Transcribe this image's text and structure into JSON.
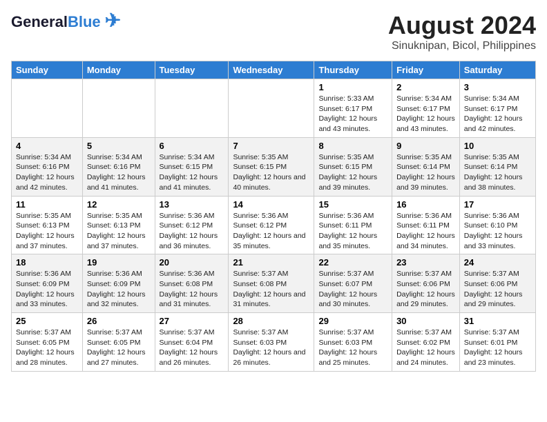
{
  "logo": {
    "line1a": "General",
    "line1b": "Blue",
    "tagline": ""
  },
  "title": "August 2024",
  "subtitle": "Sinuknipan, Bicol, Philippines",
  "days_of_week": [
    "Sunday",
    "Monday",
    "Tuesday",
    "Wednesday",
    "Thursday",
    "Friday",
    "Saturday"
  ],
  "weeks": [
    [
      {
        "day": "",
        "info": ""
      },
      {
        "day": "",
        "info": ""
      },
      {
        "day": "",
        "info": ""
      },
      {
        "day": "",
        "info": ""
      },
      {
        "day": "1",
        "info": "Sunrise: 5:33 AM\nSunset: 6:17 PM\nDaylight: 12 hours\nand 43 minutes."
      },
      {
        "day": "2",
        "info": "Sunrise: 5:34 AM\nSunset: 6:17 PM\nDaylight: 12 hours\nand 43 minutes."
      },
      {
        "day": "3",
        "info": "Sunrise: 5:34 AM\nSunset: 6:17 PM\nDaylight: 12 hours\nand 42 minutes."
      }
    ],
    [
      {
        "day": "4",
        "info": "Sunrise: 5:34 AM\nSunset: 6:16 PM\nDaylight: 12 hours\nand 42 minutes."
      },
      {
        "day": "5",
        "info": "Sunrise: 5:34 AM\nSunset: 6:16 PM\nDaylight: 12 hours\nand 41 minutes."
      },
      {
        "day": "6",
        "info": "Sunrise: 5:34 AM\nSunset: 6:15 PM\nDaylight: 12 hours\nand 41 minutes."
      },
      {
        "day": "7",
        "info": "Sunrise: 5:35 AM\nSunset: 6:15 PM\nDaylight: 12 hours\nand 40 minutes."
      },
      {
        "day": "8",
        "info": "Sunrise: 5:35 AM\nSunset: 6:15 PM\nDaylight: 12 hours\nand 39 minutes."
      },
      {
        "day": "9",
        "info": "Sunrise: 5:35 AM\nSunset: 6:14 PM\nDaylight: 12 hours\nand 39 minutes."
      },
      {
        "day": "10",
        "info": "Sunrise: 5:35 AM\nSunset: 6:14 PM\nDaylight: 12 hours\nand 38 minutes."
      }
    ],
    [
      {
        "day": "11",
        "info": "Sunrise: 5:35 AM\nSunset: 6:13 PM\nDaylight: 12 hours\nand 37 minutes."
      },
      {
        "day": "12",
        "info": "Sunrise: 5:35 AM\nSunset: 6:13 PM\nDaylight: 12 hours\nand 37 minutes."
      },
      {
        "day": "13",
        "info": "Sunrise: 5:36 AM\nSunset: 6:12 PM\nDaylight: 12 hours\nand 36 minutes."
      },
      {
        "day": "14",
        "info": "Sunrise: 5:36 AM\nSunset: 6:12 PM\nDaylight: 12 hours\nand 35 minutes."
      },
      {
        "day": "15",
        "info": "Sunrise: 5:36 AM\nSunset: 6:11 PM\nDaylight: 12 hours\nand 35 minutes."
      },
      {
        "day": "16",
        "info": "Sunrise: 5:36 AM\nSunset: 6:11 PM\nDaylight: 12 hours\nand 34 minutes."
      },
      {
        "day": "17",
        "info": "Sunrise: 5:36 AM\nSunset: 6:10 PM\nDaylight: 12 hours\nand 33 minutes."
      }
    ],
    [
      {
        "day": "18",
        "info": "Sunrise: 5:36 AM\nSunset: 6:09 PM\nDaylight: 12 hours\nand 33 minutes."
      },
      {
        "day": "19",
        "info": "Sunrise: 5:36 AM\nSunset: 6:09 PM\nDaylight: 12 hours\nand 32 minutes."
      },
      {
        "day": "20",
        "info": "Sunrise: 5:36 AM\nSunset: 6:08 PM\nDaylight: 12 hours\nand 31 minutes."
      },
      {
        "day": "21",
        "info": "Sunrise: 5:37 AM\nSunset: 6:08 PM\nDaylight: 12 hours\nand 31 minutes."
      },
      {
        "day": "22",
        "info": "Sunrise: 5:37 AM\nSunset: 6:07 PM\nDaylight: 12 hours\nand 30 minutes."
      },
      {
        "day": "23",
        "info": "Sunrise: 5:37 AM\nSunset: 6:06 PM\nDaylight: 12 hours\nand 29 minutes."
      },
      {
        "day": "24",
        "info": "Sunrise: 5:37 AM\nSunset: 6:06 PM\nDaylight: 12 hours\nand 29 minutes."
      }
    ],
    [
      {
        "day": "25",
        "info": "Sunrise: 5:37 AM\nSunset: 6:05 PM\nDaylight: 12 hours\nand 28 minutes."
      },
      {
        "day": "26",
        "info": "Sunrise: 5:37 AM\nSunset: 6:05 PM\nDaylight: 12 hours\nand 27 minutes."
      },
      {
        "day": "27",
        "info": "Sunrise: 5:37 AM\nSunset: 6:04 PM\nDaylight: 12 hours\nand 26 minutes."
      },
      {
        "day": "28",
        "info": "Sunrise: 5:37 AM\nSunset: 6:03 PM\nDaylight: 12 hours\nand 26 minutes."
      },
      {
        "day": "29",
        "info": "Sunrise: 5:37 AM\nSunset: 6:03 PM\nDaylight: 12 hours\nand 25 minutes."
      },
      {
        "day": "30",
        "info": "Sunrise: 5:37 AM\nSunset: 6:02 PM\nDaylight: 12 hours\nand 24 minutes."
      },
      {
        "day": "31",
        "info": "Sunrise: 5:37 AM\nSunset: 6:01 PM\nDaylight: 12 hours\nand 23 minutes."
      }
    ]
  ]
}
